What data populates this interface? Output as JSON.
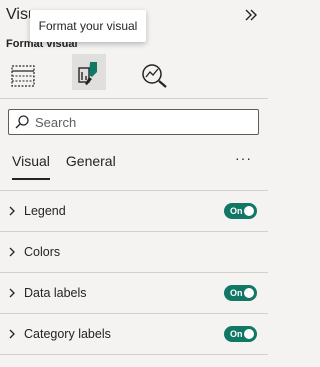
{
  "pane": {
    "title": "Visu",
    "subtitle": "Format visual",
    "tooltip": "Format your visual"
  },
  "icons": {
    "collapse": "double-chevron-right-icon",
    "tab_build": "table-icon",
    "tab_format": "format-brush-icon",
    "tab_analytics": "analytics-magnifier-icon",
    "search": "search-icon",
    "chevron": "chevron-right-icon"
  },
  "search": {
    "placeholder": "Search"
  },
  "subtabs": [
    {
      "label": "Visual",
      "active": true
    },
    {
      "label": "General",
      "active": false
    }
  ],
  "more_label": "···",
  "sections": [
    {
      "label": "Legend",
      "toggle": "On",
      "has_toggle": true
    },
    {
      "label": "Colors",
      "has_toggle": false
    },
    {
      "label": "Data labels",
      "toggle": "On",
      "has_toggle": true
    },
    {
      "label": "Category labels",
      "toggle": "On",
      "has_toggle": true
    }
  ],
  "colors": {
    "toggle_on": "#117865",
    "active_tab_bg": "#e1dfdd",
    "format_icon_accent": "#117865"
  }
}
